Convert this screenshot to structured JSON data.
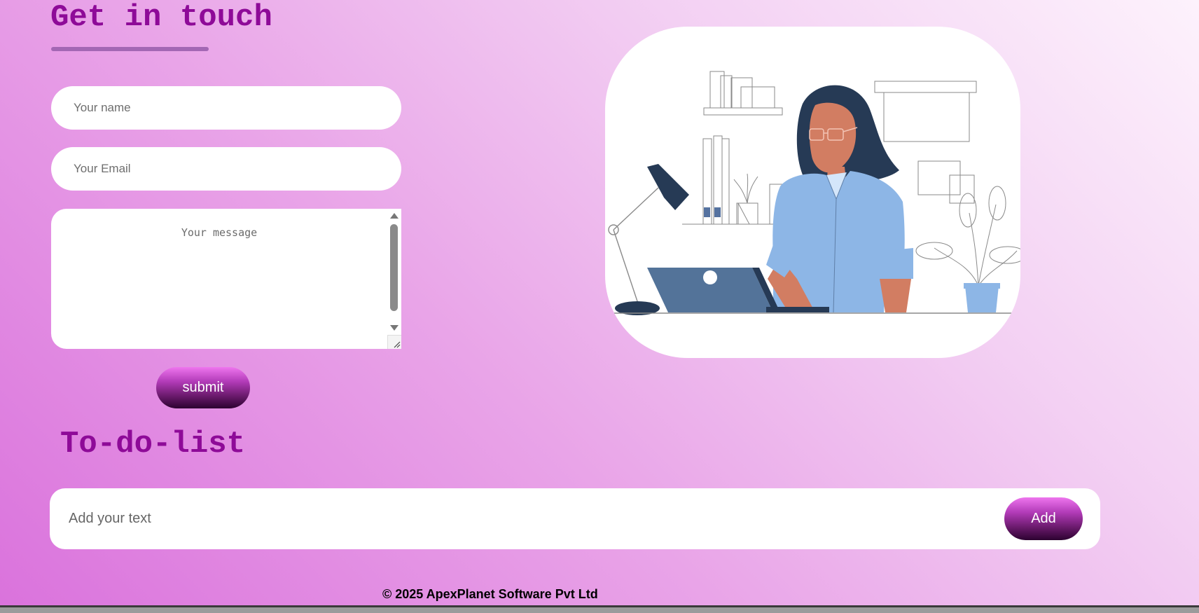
{
  "contact": {
    "title": "Get in touch",
    "name_placeholder": "Your name",
    "email_placeholder": "Your Email",
    "message_placeholder": "Your message",
    "submit_label": "submit"
  },
  "illustration": {
    "icon": "woman-working-on-laptop-illustration"
  },
  "todo": {
    "title": "To-do-list",
    "input_placeholder": "Add your text",
    "add_label": "Add"
  },
  "footer": {
    "copyright": "© 2025 ApexPlanet Software Pvt Ltd"
  },
  "colors": {
    "heading": "#8e0a98",
    "underline": "#a367b4",
    "button_top": "#ee75ee",
    "button_bottom": "#2c0230",
    "background_start": "#da72dc",
    "background_end": "#fdf2fc"
  }
}
